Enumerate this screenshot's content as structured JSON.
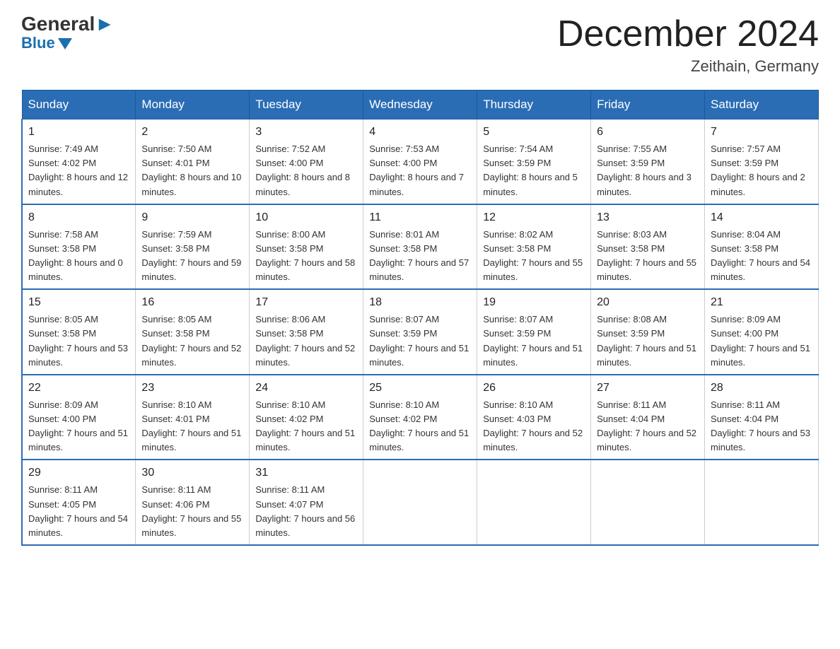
{
  "header": {
    "logo_general": "General",
    "logo_blue": "Blue",
    "month_title": "December 2024",
    "location": "Zeithain, Germany"
  },
  "days_of_week": [
    "Sunday",
    "Monday",
    "Tuesday",
    "Wednesday",
    "Thursday",
    "Friday",
    "Saturday"
  ],
  "weeks": [
    [
      {
        "day": "1",
        "sunrise": "7:49 AM",
        "sunset": "4:02 PM",
        "daylight": "8 hours and 12 minutes."
      },
      {
        "day": "2",
        "sunrise": "7:50 AM",
        "sunset": "4:01 PM",
        "daylight": "8 hours and 10 minutes."
      },
      {
        "day": "3",
        "sunrise": "7:52 AM",
        "sunset": "4:00 PM",
        "daylight": "8 hours and 8 minutes."
      },
      {
        "day": "4",
        "sunrise": "7:53 AM",
        "sunset": "4:00 PM",
        "daylight": "8 hours and 7 minutes."
      },
      {
        "day": "5",
        "sunrise": "7:54 AM",
        "sunset": "3:59 PM",
        "daylight": "8 hours and 5 minutes."
      },
      {
        "day": "6",
        "sunrise": "7:55 AM",
        "sunset": "3:59 PM",
        "daylight": "8 hours and 3 minutes."
      },
      {
        "day": "7",
        "sunrise": "7:57 AM",
        "sunset": "3:59 PM",
        "daylight": "8 hours and 2 minutes."
      }
    ],
    [
      {
        "day": "8",
        "sunrise": "7:58 AM",
        "sunset": "3:58 PM",
        "daylight": "8 hours and 0 minutes."
      },
      {
        "day": "9",
        "sunrise": "7:59 AM",
        "sunset": "3:58 PM",
        "daylight": "7 hours and 59 minutes."
      },
      {
        "day": "10",
        "sunrise": "8:00 AM",
        "sunset": "3:58 PM",
        "daylight": "7 hours and 58 minutes."
      },
      {
        "day": "11",
        "sunrise": "8:01 AM",
        "sunset": "3:58 PM",
        "daylight": "7 hours and 57 minutes."
      },
      {
        "day": "12",
        "sunrise": "8:02 AM",
        "sunset": "3:58 PM",
        "daylight": "7 hours and 55 minutes."
      },
      {
        "day": "13",
        "sunrise": "8:03 AM",
        "sunset": "3:58 PM",
        "daylight": "7 hours and 55 minutes."
      },
      {
        "day": "14",
        "sunrise": "8:04 AM",
        "sunset": "3:58 PM",
        "daylight": "7 hours and 54 minutes."
      }
    ],
    [
      {
        "day": "15",
        "sunrise": "8:05 AM",
        "sunset": "3:58 PM",
        "daylight": "7 hours and 53 minutes."
      },
      {
        "day": "16",
        "sunrise": "8:05 AM",
        "sunset": "3:58 PM",
        "daylight": "7 hours and 52 minutes."
      },
      {
        "day": "17",
        "sunrise": "8:06 AM",
        "sunset": "3:58 PM",
        "daylight": "7 hours and 52 minutes."
      },
      {
        "day": "18",
        "sunrise": "8:07 AM",
        "sunset": "3:59 PM",
        "daylight": "7 hours and 51 minutes."
      },
      {
        "day": "19",
        "sunrise": "8:07 AM",
        "sunset": "3:59 PM",
        "daylight": "7 hours and 51 minutes."
      },
      {
        "day": "20",
        "sunrise": "8:08 AM",
        "sunset": "3:59 PM",
        "daylight": "7 hours and 51 minutes."
      },
      {
        "day": "21",
        "sunrise": "8:09 AM",
        "sunset": "4:00 PM",
        "daylight": "7 hours and 51 minutes."
      }
    ],
    [
      {
        "day": "22",
        "sunrise": "8:09 AM",
        "sunset": "4:00 PM",
        "daylight": "7 hours and 51 minutes."
      },
      {
        "day": "23",
        "sunrise": "8:10 AM",
        "sunset": "4:01 PM",
        "daylight": "7 hours and 51 minutes."
      },
      {
        "day": "24",
        "sunrise": "8:10 AM",
        "sunset": "4:02 PM",
        "daylight": "7 hours and 51 minutes."
      },
      {
        "day": "25",
        "sunrise": "8:10 AM",
        "sunset": "4:02 PM",
        "daylight": "7 hours and 51 minutes."
      },
      {
        "day": "26",
        "sunrise": "8:10 AM",
        "sunset": "4:03 PM",
        "daylight": "7 hours and 52 minutes."
      },
      {
        "day": "27",
        "sunrise": "8:11 AM",
        "sunset": "4:04 PM",
        "daylight": "7 hours and 52 minutes."
      },
      {
        "day": "28",
        "sunrise": "8:11 AM",
        "sunset": "4:04 PM",
        "daylight": "7 hours and 53 minutes."
      }
    ],
    [
      {
        "day": "29",
        "sunrise": "8:11 AM",
        "sunset": "4:05 PM",
        "daylight": "7 hours and 54 minutes."
      },
      {
        "day": "30",
        "sunrise": "8:11 AM",
        "sunset": "4:06 PM",
        "daylight": "7 hours and 55 minutes."
      },
      {
        "day": "31",
        "sunrise": "8:11 AM",
        "sunset": "4:07 PM",
        "daylight": "7 hours and 56 minutes."
      },
      null,
      null,
      null,
      null
    ]
  ]
}
